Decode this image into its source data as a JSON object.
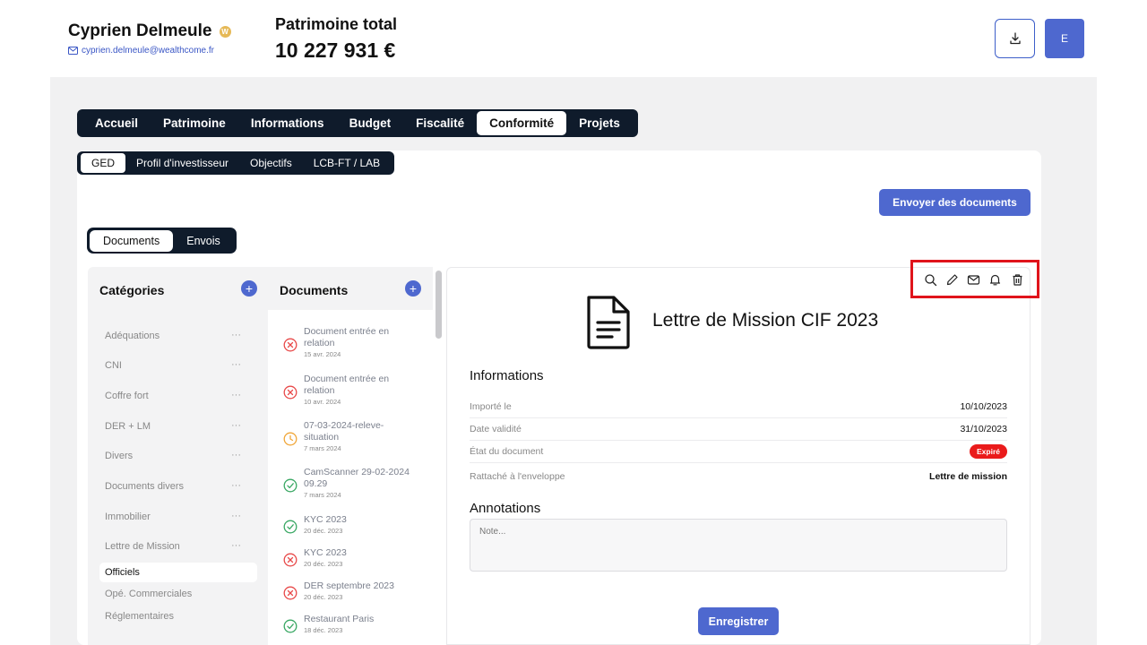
{
  "header": {
    "client_name": "Cyprien Delmeule",
    "badge_letter": "W",
    "client_email": "cyprien.delmeule@wealthcome.fr",
    "patrimoine_label": "Patrimoine total",
    "patrimoine_value": "10 227 931 €",
    "avatar_letter": "E"
  },
  "main_tabs": [
    {
      "label": "Accueil",
      "active": false
    },
    {
      "label": "Patrimoine",
      "active": false
    },
    {
      "label": "Informations",
      "active": false
    },
    {
      "label": "Budget",
      "active": false
    },
    {
      "label": "Fiscalité",
      "active": false
    },
    {
      "label": "Conformité",
      "active": true
    },
    {
      "label": "Projets",
      "active": false
    }
  ],
  "sub_tabs": [
    {
      "label": "GED",
      "active": true
    },
    {
      "label": "Profil d'investisseur",
      "active": false
    },
    {
      "label": "Objectifs",
      "active": false
    },
    {
      "label": "LCB-FT / LAB",
      "active": false
    }
  ],
  "send_button": "Envoyer des documents",
  "doc_toggle": [
    {
      "label": "Documents",
      "active": true
    },
    {
      "label": "Envois",
      "active": false
    }
  ],
  "categories": {
    "title": "Catégories",
    "items": [
      {
        "label": "Adéquations",
        "has_menu": true
      },
      {
        "label": "CNI",
        "has_menu": true
      },
      {
        "label": "Coffre fort",
        "has_menu": true
      },
      {
        "label": "DER + LM",
        "has_menu": true
      },
      {
        "label": "Divers",
        "has_menu": true
      },
      {
        "label": "Documents divers",
        "has_menu": true
      },
      {
        "label": "Immobilier",
        "has_menu": true
      },
      {
        "label": "Lettre de Mission",
        "has_menu": true
      },
      {
        "label": "Officiels",
        "has_menu": false,
        "selected": true
      },
      {
        "label": "Opé. Commerciales",
        "has_menu": false
      },
      {
        "label": "Réglementaires",
        "has_menu": false
      }
    ],
    "menu_glyph": "···"
  },
  "documents": {
    "title": "Documents",
    "items": [
      {
        "title": "Document entrée en relation",
        "date": "15 avr. 2024",
        "status": "error"
      },
      {
        "title": "Document entrée en relation",
        "date": "10 avr. 2024",
        "status": "error"
      },
      {
        "title": "07-03-2024-releve-situation",
        "date": "7 mars 2024",
        "status": "pending"
      },
      {
        "title": "CamScanner 29-02-2024 09.29",
        "date": "7 mars 2024",
        "status": "valid"
      },
      {
        "title": "KYC 2023",
        "date": "20 déc. 2023",
        "status": "valid"
      },
      {
        "title": "KYC 2023",
        "date": "20 déc. 2023",
        "status": "error"
      },
      {
        "title": "DER septembre 2023",
        "date": "20 déc. 2023",
        "status": "error"
      },
      {
        "title": "Restaurant Paris",
        "date": "18 déc. 2023",
        "status": "valid"
      }
    ]
  },
  "detail": {
    "title": "Lettre de Mission CIF 2023",
    "informations_title": "Informations",
    "rows": [
      {
        "label": "Importé le",
        "value": "10/10/2023"
      },
      {
        "label": "Date validité",
        "value": "31/10/2023"
      },
      {
        "label": "État du document",
        "value": "Expiré"
      },
      {
        "label": "Rattaché à l'enveloppe",
        "value": "Lettre de mission"
      }
    ],
    "annotations_title": "Annotations",
    "note_placeholder": "Note...",
    "save_label": "Enregistrer"
  },
  "toolbar_icons": [
    "search-icon",
    "edit-icon",
    "mail-icon",
    "bell-icon",
    "trash-icon"
  ],
  "colors": {
    "accent": "#4e68cf",
    "nav_dark": "#0f1b2b",
    "error": "#e84a4a",
    "pending": "#f0a73a",
    "valid": "#3aa864",
    "expired_badge": "#ea1b1b",
    "highlight_box": "#e0141b"
  }
}
